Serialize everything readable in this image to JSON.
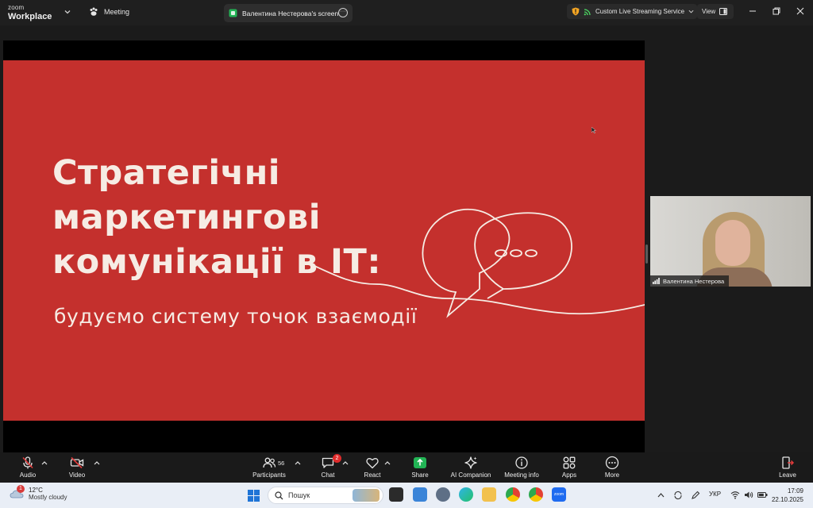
{
  "titlebar": {
    "logo_line1": "zoom",
    "logo_line2": "Workplace",
    "meeting_label": "Meeting",
    "screen_tab_label": "Валентина Нестерова's screen",
    "stream_label": "Custom Live Streaming Service",
    "view_label": "View"
  },
  "slide": {
    "title_lines": [
      "Стратегічні",
      "маркетингові",
      "комунікації в ІТ:"
    ],
    "subtitle": "будуємо систему точок взаємодії"
  },
  "video": {
    "participant_name": "Валентина Нестерова"
  },
  "toolbar": {
    "audio_label": "Audio",
    "video_label": "Video",
    "participants_label": "Participants",
    "participants_count": "56",
    "chat_label": "Chat",
    "chat_badge": "2",
    "react_label": "React",
    "share_label": "Share",
    "ai_label": "AI Companion",
    "info_label": "Meeting info",
    "apps_label": "Apps",
    "more_label": "More",
    "leave_label": "Leave"
  },
  "taskbar": {
    "weather_temp": "12°C",
    "weather_desc": "Mostly cloudy",
    "weather_badge": "1",
    "search_placeholder": "Пошук",
    "lang": "УКР",
    "time": "17:09",
    "date": "22.10.2025",
    "zoom_app_badge": "12"
  },
  "colors": {
    "slide_red": "#c4302d",
    "share_green": "#22b455",
    "taskbar_bg": "#e9eef6"
  }
}
